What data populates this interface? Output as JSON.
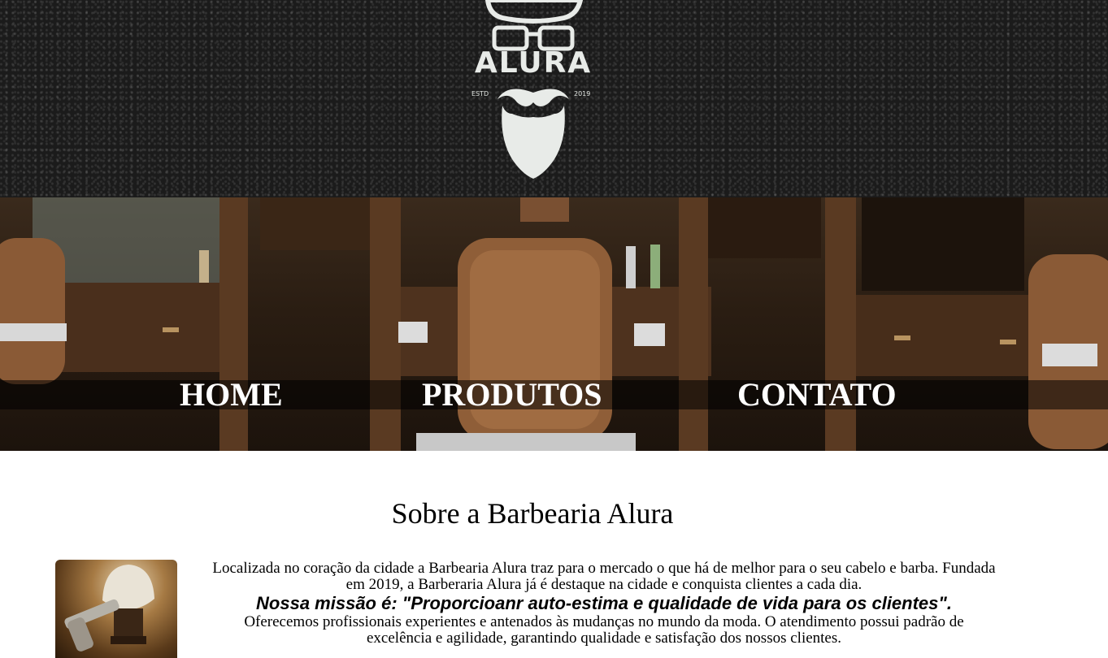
{
  "header": {
    "logo_text": "ALURA",
    "logo_estd": "ESTD",
    "logo_year": "2019"
  },
  "nav": {
    "items": [
      {
        "label": "HOME"
      },
      {
        "label": "PRODUTOS"
      },
      {
        "label": "CONTATO"
      }
    ]
  },
  "about": {
    "title": "Sobre a Barbearia Alura",
    "paragraph_1": "Localizada no coração da cidade a Barbearia Alura traz para o mercado o que há de melhor para o seu cabelo e barba. Fundada em 2019, a Barberaria Alura já é destaque na cidade e conquista clientes a cada dia.",
    "mission": "Nossa missão é: \"Proporcioanr auto-estima e qualidade de vida para os clientes\".",
    "paragraph_2": "Oferecemos profissionais experientes e antenados às mudanças no mundo da moda. O atendimento possui padrão de excelência e agilidade, garantindo qualidade e satisfação dos nossos clientes."
  },
  "colors": {
    "header_bg": "#1b1b1b",
    "logo": "#e8ebe8",
    "nav_text": "#ffffff",
    "banner_wood": "#5a3a22"
  }
}
